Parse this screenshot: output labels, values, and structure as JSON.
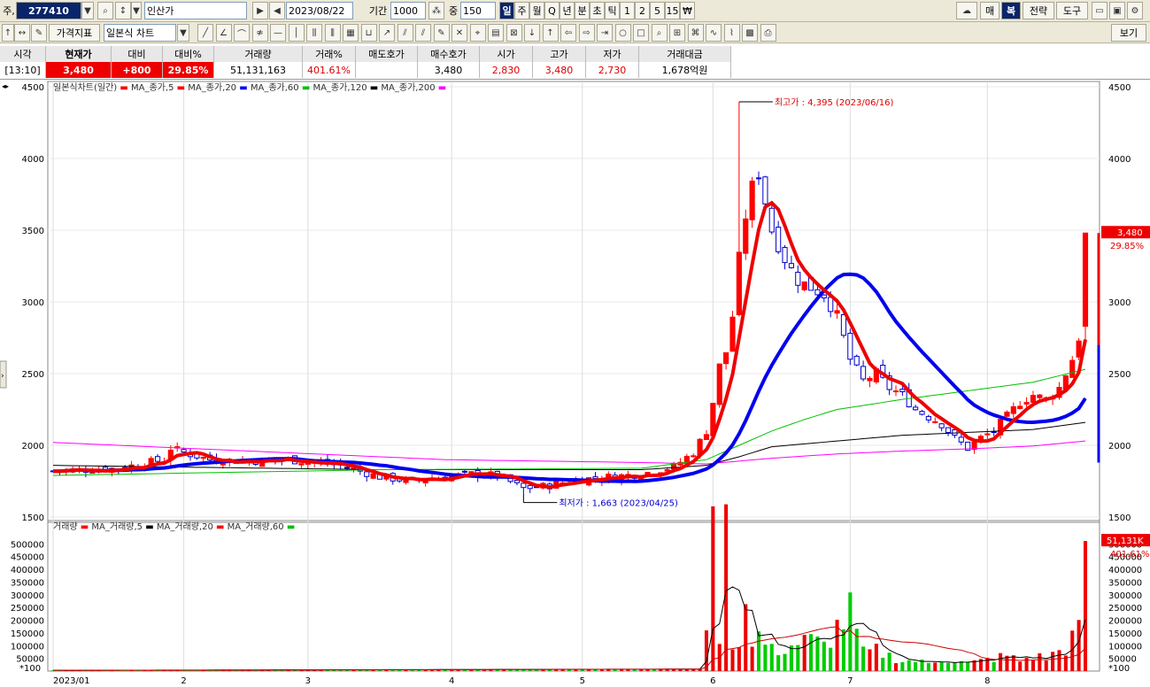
{
  "toolbar1": {
    "prefix": "주,",
    "code": "277410",
    "name": "인산가",
    "date": "2023/08/22",
    "period_label": "기간",
    "period": "1000",
    "count_label": "중",
    "count": "150",
    "timeframes": [
      "일",
      "주",
      "월",
      "Q",
      "년",
      "분",
      "초",
      "틱",
      "1",
      "2",
      "5",
      "15",
      "₩"
    ],
    "right_buttons": [
      "매",
      "복",
      "전략",
      "도구"
    ]
  },
  "toolbar2": {
    "indicator": "가격지표",
    "chart_type": "일본식 차트",
    "view_button": "보기"
  },
  "quote": {
    "headers": [
      "시각",
      "현재가",
      "대비",
      "대비%",
      "거래량",
      "거래%",
      "매도호가",
      "매수호가",
      "시가",
      "고가",
      "저가",
      "거래대금"
    ],
    "values": [
      "[13:10]",
      "3,480",
      "+800",
      "29.85%",
      "51,131,163",
      "401.61%",
      "",
      "3,480",
      "2,830",
      "3,480",
      "2,730",
      "1,678억원"
    ]
  },
  "chart_data": {
    "type": "candlestick",
    "title": "일본식차트(일간)",
    "price_legend": [
      {
        "label": "MA_종가,5",
        "color": "#ff0000"
      },
      {
        "label": "MA_종가,20",
        "color": "#ff0000"
      },
      {
        "label": "MA_종가,60",
        "color": "#0000ff"
      },
      {
        "label": "MA_종가,120",
        "color": "#00c000"
      },
      {
        "label": "MA_종가,200",
        "color": "#000000"
      },
      {
        "label": "",
        "color": "#ff00ff"
      }
    ],
    "volume_title": "거래량",
    "volume_legend": [
      {
        "label": "MA_거래량,5",
        "color": "#ff0000"
      },
      {
        "label": "MA_거래량,20",
        "color": "#000000"
      },
      {
        "label": "MA_거래량,60",
        "color": "#ff0000"
      },
      {
        "label": "",
        "color": "#00c000"
      }
    ],
    "price_ylim": [
      1500,
      4500
    ],
    "price_ticks": [
      1500,
      2000,
      2500,
      3000,
      3500,
      4000,
      4500
    ],
    "volume_ylim": [
      0,
      550000
    ],
    "volume_ticks": [
      50000,
      100000,
      150000,
      200000,
      250000,
      300000,
      350000,
      400000,
      450000,
      500000
    ],
    "volume_unit": "*100",
    "x_labels": [
      {
        "i": 0,
        "label": "2023/01"
      },
      {
        "i": 20,
        "label": "2"
      },
      {
        "i": 39,
        "label": "3"
      },
      {
        "i": 61,
        "label": "4"
      },
      {
        "i": 81,
        "label": "5"
      },
      {
        "i": 101,
        "label": "6"
      },
      {
        "i": 122,
        "label": "7"
      },
      {
        "i": 143,
        "label": "8"
      }
    ],
    "high_annotation": {
      "text": "최고가 : 4,395 (2023/06/16)",
      "price": 4395,
      "i": 105
    },
    "low_annotation": {
      "text": "최저가 : 1,663 (2023/04/25)",
      "price": 1663,
      "i": 72
    },
    "current_price": {
      "value": "3,480",
      "pct": "29.85%",
      "price": 3480
    },
    "current_volume": {
      "value": "51,131K",
      "pct": "401.61%",
      "volume": 511311
    },
    "price_keys": [
      [
        0,
        1820
      ],
      [
        10,
        1840
      ],
      [
        17,
        1900
      ],
      [
        18,
        1980
      ],
      [
        20,
        1950
      ],
      [
        24,
        1900
      ],
      [
        30,
        1890
      ],
      [
        36,
        1900
      ],
      [
        40,
        1880
      ],
      [
        44,
        1860
      ],
      [
        50,
        1780
      ],
      [
        55,
        1750
      ],
      [
        60,
        1780
      ],
      [
        64,
        1800
      ],
      [
        68,
        1790
      ],
      [
        72,
        1700
      ],
      [
        76,
        1720
      ],
      [
        80,
        1760
      ],
      [
        85,
        1780
      ],
      [
        90,
        1800
      ],
      [
        95,
        1850
      ],
      [
        98,
        1950
      ],
      [
        100,
        2100
      ],
      [
        101,
        2300
      ],
      [
        102,
        2550
      ],
      [
        103,
        2650
      ],
      [
        104,
        2900
      ],
      [
        105,
        3300
      ],
      [
        106,
        3600
      ],
      [
        107,
        3800
      ],
      [
        108,
        3900
      ],
      [
        109,
        3700
      ],
      [
        110,
        3500
      ],
      [
        112,
        3300
      ],
      [
        114,
        3150
      ],
      [
        116,
        3100
      ],
      [
        118,
        3050
      ],
      [
        120,
        2900
      ],
      [
        122,
        2600
      ],
      [
        124,
        2450
      ],
      [
        126,
        2500
      ],
      [
        128,
        2400
      ],
      [
        130,
        2350
      ],
      [
        132,
        2250
      ],
      [
        134,
        2200
      ],
      [
        136,
        2150
      ],
      [
        138,
        2050
      ],
      [
        140,
        1980
      ],
      [
        142,
        2050
      ],
      [
        144,
        2100
      ],
      [
        146,
        2200
      ],
      [
        148,
        2300
      ],
      [
        150,
        2350
      ],
      [
        152,
        2320
      ],
      [
        154,
        2400
      ],
      [
        156,
        2600
      ],
      [
        157,
        2750
      ],
      [
        158,
        3480
      ]
    ],
    "volume_keys": [
      [
        0,
        3000
      ],
      [
        99,
        8000
      ],
      [
        100,
        160000
      ],
      [
        101,
        470000
      ],
      [
        102,
        160000
      ],
      [
        103,
        520000
      ],
      [
        104,
        130000
      ],
      [
        105,
        100000
      ],
      [
        106,
        380000
      ],
      [
        107,
        90000
      ],
      [
        108,
        140000
      ],
      [
        110,
        80000
      ],
      [
        112,
        90000
      ],
      [
        114,
        110000
      ],
      [
        116,
        120000
      ],
      [
        118,
        100000
      ],
      [
        120,
        170000
      ],
      [
        122,
        230000
      ],
      [
        124,
        70000
      ],
      [
        126,
        80000
      ],
      [
        128,
        60000
      ],
      [
        130,
        40000
      ],
      [
        132,
        40000
      ],
      [
        134,
        30000
      ],
      [
        136,
        50000
      ],
      [
        138,
        40000
      ],
      [
        140,
        30000
      ],
      [
        142,
        40000
      ],
      [
        144,
        50000
      ],
      [
        146,
        60000
      ],
      [
        148,
        40000
      ],
      [
        150,
        60000
      ],
      [
        152,
        50000
      ],
      [
        154,
        80000
      ],
      [
        155,
        90000
      ],
      [
        156,
        130000
      ],
      [
        157,
        150000
      ],
      [
        158,
        511311
      ]
    ],
    "ma120_keys": [
      [
        0,
        1790
      ],
      [
        50,
        1830
      ],
      [
        90,
        1840
      ],
      [
        100,
        1900
      ],
      [
        105,
        2000
      ],
      [
        110,
        2100
      ],
      [
        115,
        2180
      ],
      [
        120,
        2250
      ],
      [
        130,
        2320
      ],
      [
        140,
        2380
      ],
      [
        150,
        2440
      ],
      [
        158,
        2530
      ]
    ],
    "ma200_keys": [
      [
        0,
        1860
      ],
      [
        50,
        1830
      ],
      [
        90,
        1830
      ],
      [
        100,
        1860
      ],
      [
        105,
        1920
      ],
      [
        110,
        1990
      ],
      [
        120,
        2030
      ],
      [
        130,
        2070
      ],
      [
        140,
        2090
      ],
      [
        150,
        2110
      ],
      [
        158,
        2160
      ]
    ],
    "pink_keys": [
      [
        0,
        2020
      ],
      [
        30,
        1960
      ],
      [
        60,
        1900
      ],
      [
        90,
        1880
      ],
      [
        100,
        1870
      ],
      [
        110,
        1910
      ],
      [
        120,
        1940
      ],
      [
        130,
        1960
      ],
      [
        140,
        1975
      ],
      [
        150,
        1995
      ],
      [
        158,
        2030
      ]
    ]
  }
}
